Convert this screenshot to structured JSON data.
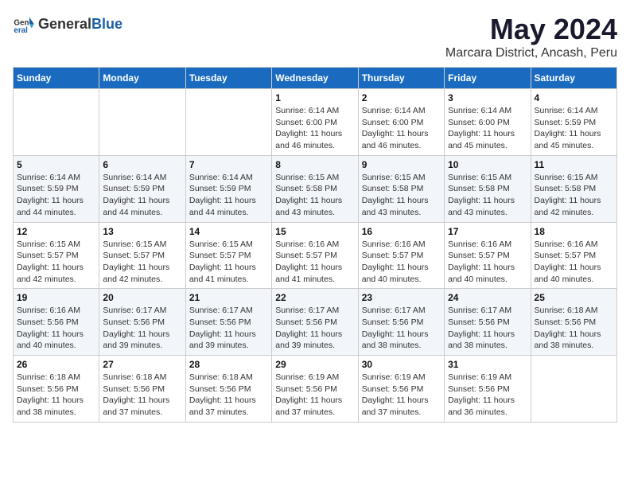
{
  "header": {
    "logo_general": "General",
    "logo_blue": "Blue",
    "month_title": "May 2024",
    "location": "Marcara District, Ancash, Peru"
  },
  "weekdays": [
    "Sunday",
    "Monday",
    "Tuesday",
    "Wednesday",
    "Thursday",
    "Friday",
    "Saturday"
  ],
  "weeks": [
    [
      {
        "day": "",
        "info": ""
      },
      {
        "day": "",
        "info": ""
      },
      {
        "day": "",
        "info": ""
      },
      {
        "day": "1",
        "info": "Sunrise: 6:14 AM\nSunset: 6:00 PM\nDaylight: 11 hours\nand 46 minutes."
      },
      {
        "day": "2",
        "info": "Sunrise: 6:14 AM\nSunset: 6:00 PM\nDaylight: 11 hours\nand 46 minutes."
      },
      {
        "day": "3",
        "info": "Sunrise: 6:14 AM\nSunset: 6:00 PM\nDaylight: 11 hours\nand 45 minutes."
      },
      {
        "day": "4",
        "info": "Sunrise: 6:14 AM\nSunset: 5:59 PM\nDaylight: 11 hours\nand 45 minutes."
      }
    ],
    [
      {
        "day": "5",
        "info": "Sunrise: 6:14 AM\nSunset: 5:59 PM\nDaylight: 11 hours\nand 44 minutes."
      },
      {
        "day": "6",
        "info": "Sunrise: 6:14 AM\nSunset: 5:59 PM\nDaylight: 11 hours\nand 44 minutes."
      },
      {
        "day": "7",
        "info": "Sunrise: 6:14 AM\nSunset: 5:59 PM\nDaylight: 11 hours\nand 44 minutes."
      },
      {
        "day": "8",
        "info": "Sunrise: 6:15 AM\nSunset: 5:58 PM\nDaylight: 11 hours\nand 43 minutes."
      },
      {
        "day": "9",
        "info": "Sunrise: 6:15 AM\nSunset: 5:58 PM\nDaylight: 11 hours\nand 43 minutes."
      },
      {
        "day": "10",
        "info": "Sunrise: 6:15 AM\nSunset: 5:58 PM\nDaylight: 11 hours\nand 43 minutes."
      },
      {
        "day": "11",
        "info": "Sunrise: 6:15 AM\nSunset: 5:58 PM\nDaylight: 11 hours\nand 42 minutes."
      }
    ],
    [
      {
        "day": "12",
        "info": "Sunrise: 6:15 AM\nSunset: 5:57 PM\nDaylight: 11 hours\nand 42 minutes."
      },
      {
        "day": "13",
        "info": "Sunrise: 6:15 AM\nSunset: 5:57 PM\nDaylight: 11 hours\nand 42 minutes."
      },
      {
        "day": "14",
        "info": "Sunrise: 6:15 AM\nSunset: 5:57 PM\nDaylight: 11 hours\nand 41 minutes."
      },
      {
        "day": "15",
        "info": "Sunrise: 6:16 AM\nSunset: 5:57 PM\nDaylight: 11 hours\nand 41 minutes."
      },
      {
        "day": "16",
        "info": "Sunrise: 6:16 AM\nSunset: 5:57 PM\nDaylight: 11 hours\nand 40 minutes."
      },
      {
        "day": "17",
        "info": "Sunrise: 6:16 AM\nSunset: 5:57 PM\nDaylight: 11 hours\nand 40 minutes."
      },
      {
        "day": "18",
        "info": "Sunrise: 6:16 AM\nSunset: 5:57 PM\nDaylight: 11 hours\nand 40 minutes."
      }
    ],
    [
      {
        "day": "19",
        "info": "Sunrise: 6:16 AM\nSunset: 5:56 PM\nDaylight: 11 hours\nand 40 minutes."
      },
      {
        "day": "20",
        "info": "Sunrise: 6:17 AM\nSunset: 5:56 PM\nDaylight: 11 hours\nand 39 minutes."
      },
      {
        "day": "21",
        "info": "Sunrise: 6:17 AM\nSunset: 5:56 PM\nDaylight: 11 hours\nand 39 minutes."
      },
      {
        "day": "22",
        "info": "Sunrise: 6:17 AM\nSunset: 5:56 PM\nDaylight: 11 hours\nand 39 minutes."
      },
      {
        "day": "23",
        "info": "Sunrise: 6:17 AM\nSunset: 5:56 PM\nDaylight: 11 hours\nand 38 minutes."
      },
      {
        "day": "24",
        "info": "Sunrise: 6:17 AM\nSunset: 5:56 PM\nDaylight: 11 hours\nand 38 minutes."
      },
      {
        "day": "25",
        "info": "Sunrise: 6:18 AM\nSunset: 5:56 PM\nDaylight: 11 hours\nand 38 minutes."
      }
    ],
    [
      {
        "day": "26",
        "info": "Sunrise: 6:18 AM\nSunset: 5:56 PM\nDaylight: 11 hours\nand 38 minutes."
      },
      {
        "day": "27",
        "info": "Sunrise: 6:18 AM\nSunset: 5:56 PM\nDaylight: 11 hours\nand 37 minutes."
      },
      {
        "day": "28",
        "info": "Sunrise: 6:18 AM\nSunset: 5:56 PM\nDaylight: 11 hours\nand 37 minutes."
      },
      {
        "day": "29",
        "info": "Sunrise: 6:19 AM\nSunset: 5:56 PM\nDaylight: 11 hours\nand 37 minutes."
      },
      {
        "day": "30",
        "info": "Sunrise: 6:19 AM\nSunset: 5:56 PM\nDaylight: 11 hours\nand 37 minutes."
      },
      {
        "day": "31",
        "info": "Sunrise: 6:19 AM\nSunset: 5:56 PM\nDaylight: 11 hours\nand 36 minutes."
      },
      {
        "day": "",
        "info": ""
      }
    ]
  ]
}
